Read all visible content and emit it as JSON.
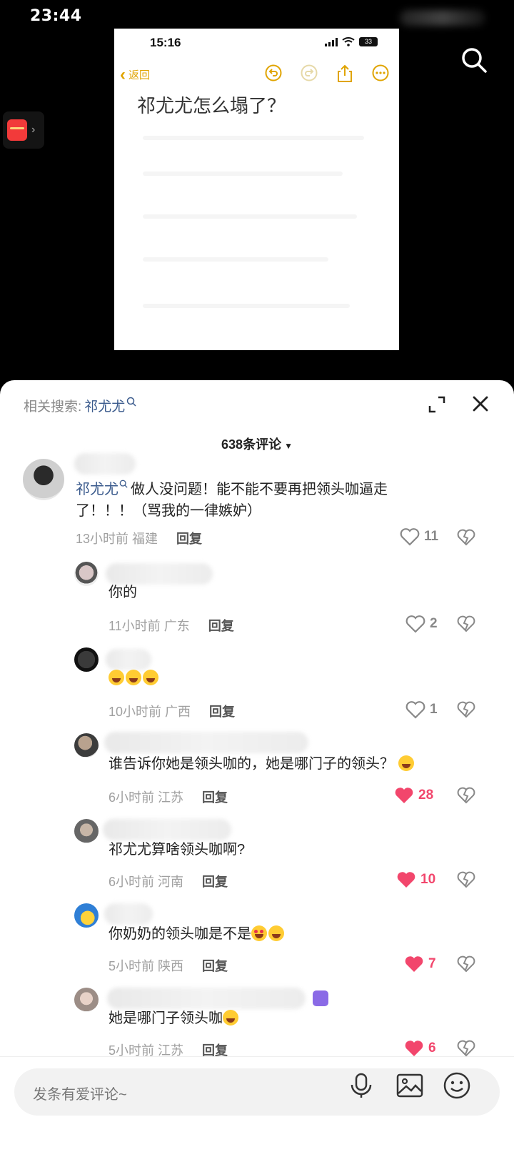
{
  "status_bar": {
    "time": "23:44"
  },
  "video": {
    "screenshot": {
      "time": "15:16",
      "battery": "33",
      "back_label": "返回",
      "note_title": "祁尤尤怎么塌了？"
    }
  },
  "panel": {
    "related_label": "相关搜索:",
    "related_keyword": "祁尤尤",
    "comment_count": "638条评论"
  },
  "comments": [
    {
      "tag": "祁尤尤",
      "text": "做人没问题！能不能不要再把领头咖逼走",
      "text2": "了！！！（骂我的一律嫉妒）",
      "time": "13小时前",
      "location": "福建",
      "reply": "回复",
      "likes": "11",
      "liked": false
    },
    {
      "text": "你的",
      "time": "11小时前",
      "location": "广东",
      "reply": "回复",
      "likes": "2",
      "liked": false
    },
    {
      "text": "",
      "time": "10小时前",
      "location": "广西",
      "reply": "回复",
      "likes": "1",
      "liked": false
    },
    {
      "text": "谁告诉你她是领头咖的，她是哪门子的领头？",
      "time": "6小时前",
      "location": "江苏",
      "reply": "回复",
      "likes": "28",
      "liked": true
    },
    {
      "text": "祁尤尤算啥领头咖啊?",
      "time": "6小时前",
      "location": "河南",
      "reply": "回复",
      "likes": "10",
      "liked": true
    },
    {
      "text": "你奶奶的领头咖是不是",
      "time": "5小时前",
      "location": "陕西",
      "reply": "回复",
      "likes": "7",
      "liked": true
    },
    {
      "text": "她是哪门子领头咖",
      "time": "5小时前",
      "location": "江苏",
      "reply": "回复",
      "likes": "6",
      "liked": true
    }
  ],
  "bottom": {
    "placeholder": "发条有爱评论~"
  },
  "colors": {
    "accent_like": "#f2466c",
    "tag_blue": "#3a5a8c",
    "note_yellow": "#e0a400"
  },
  "icons": [
    "search-icon",
    "close-icon",
    "expand-icon",
    "heart-icon",
    "broken-heart-icon",
    "mic-icon",
    "image-icon",
    "emoji-icon"
  ]
}
